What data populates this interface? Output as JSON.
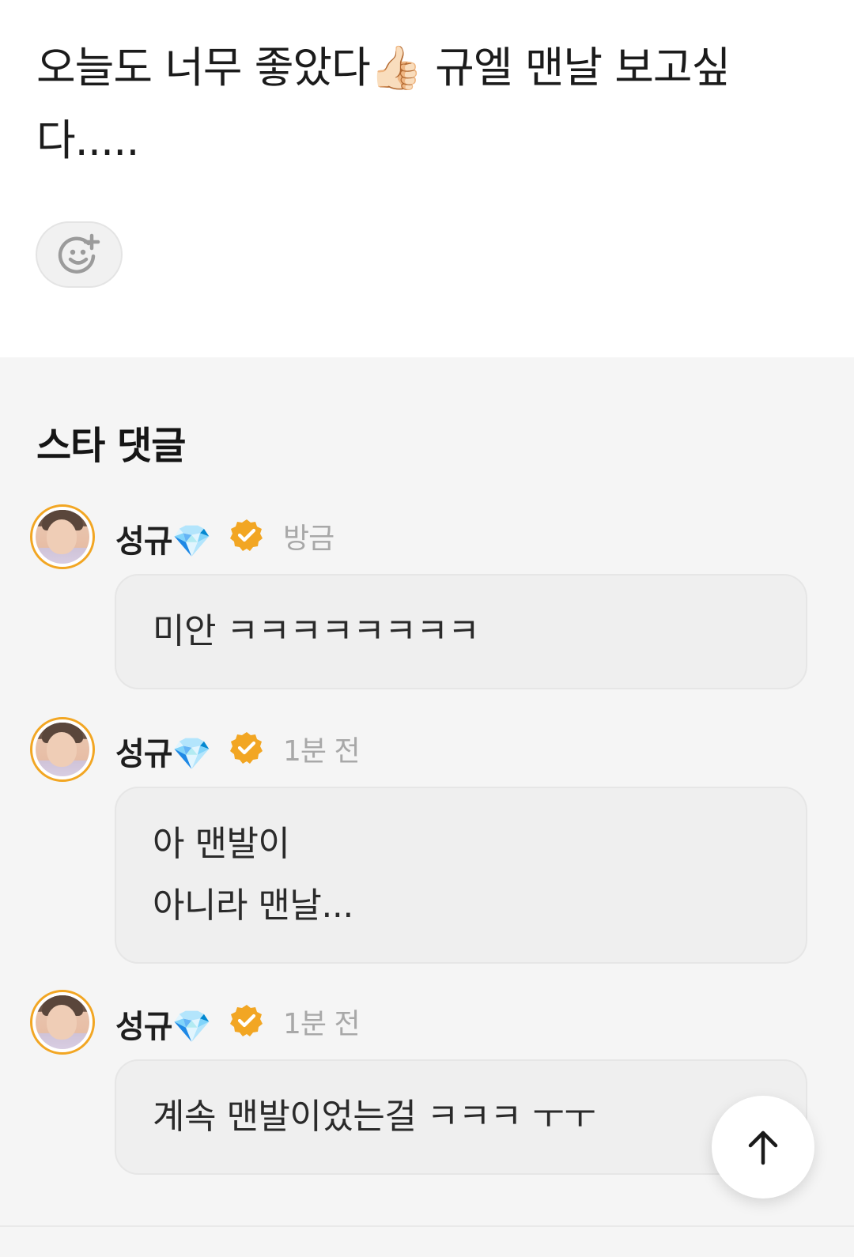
{
  "post": {
    "text": "오늘도 너무 좋았다👍🏻 규엘 맨날 보고싶다.....",
    "reaction_icon": "add-reaction-smile-icon"
  },
  "comments_section": {
    "title": "스타 댓글",
    "accent_color": "#f2a623",
    "items": [
      {
        "name": "성규💎",
        "time": "방금",
        "text": "미안 ㅋㅋㅋㅋㅋㅋㅋㅋ"
      },
      {
        "name": "성규💎",
        "time": "1분 전",
        "text": "아 맨발이\n아니라 맨날..."
      },
      {
        "name": "성규💎",
        "time": "1분 전",
        "text": "계속 맨발이었는걸 ㅋㅋㅋ ㅜㅜ"
      }
    ]
  },
  "scroll_top": {
    "icon": "arrow-up-icon"
  }
}
